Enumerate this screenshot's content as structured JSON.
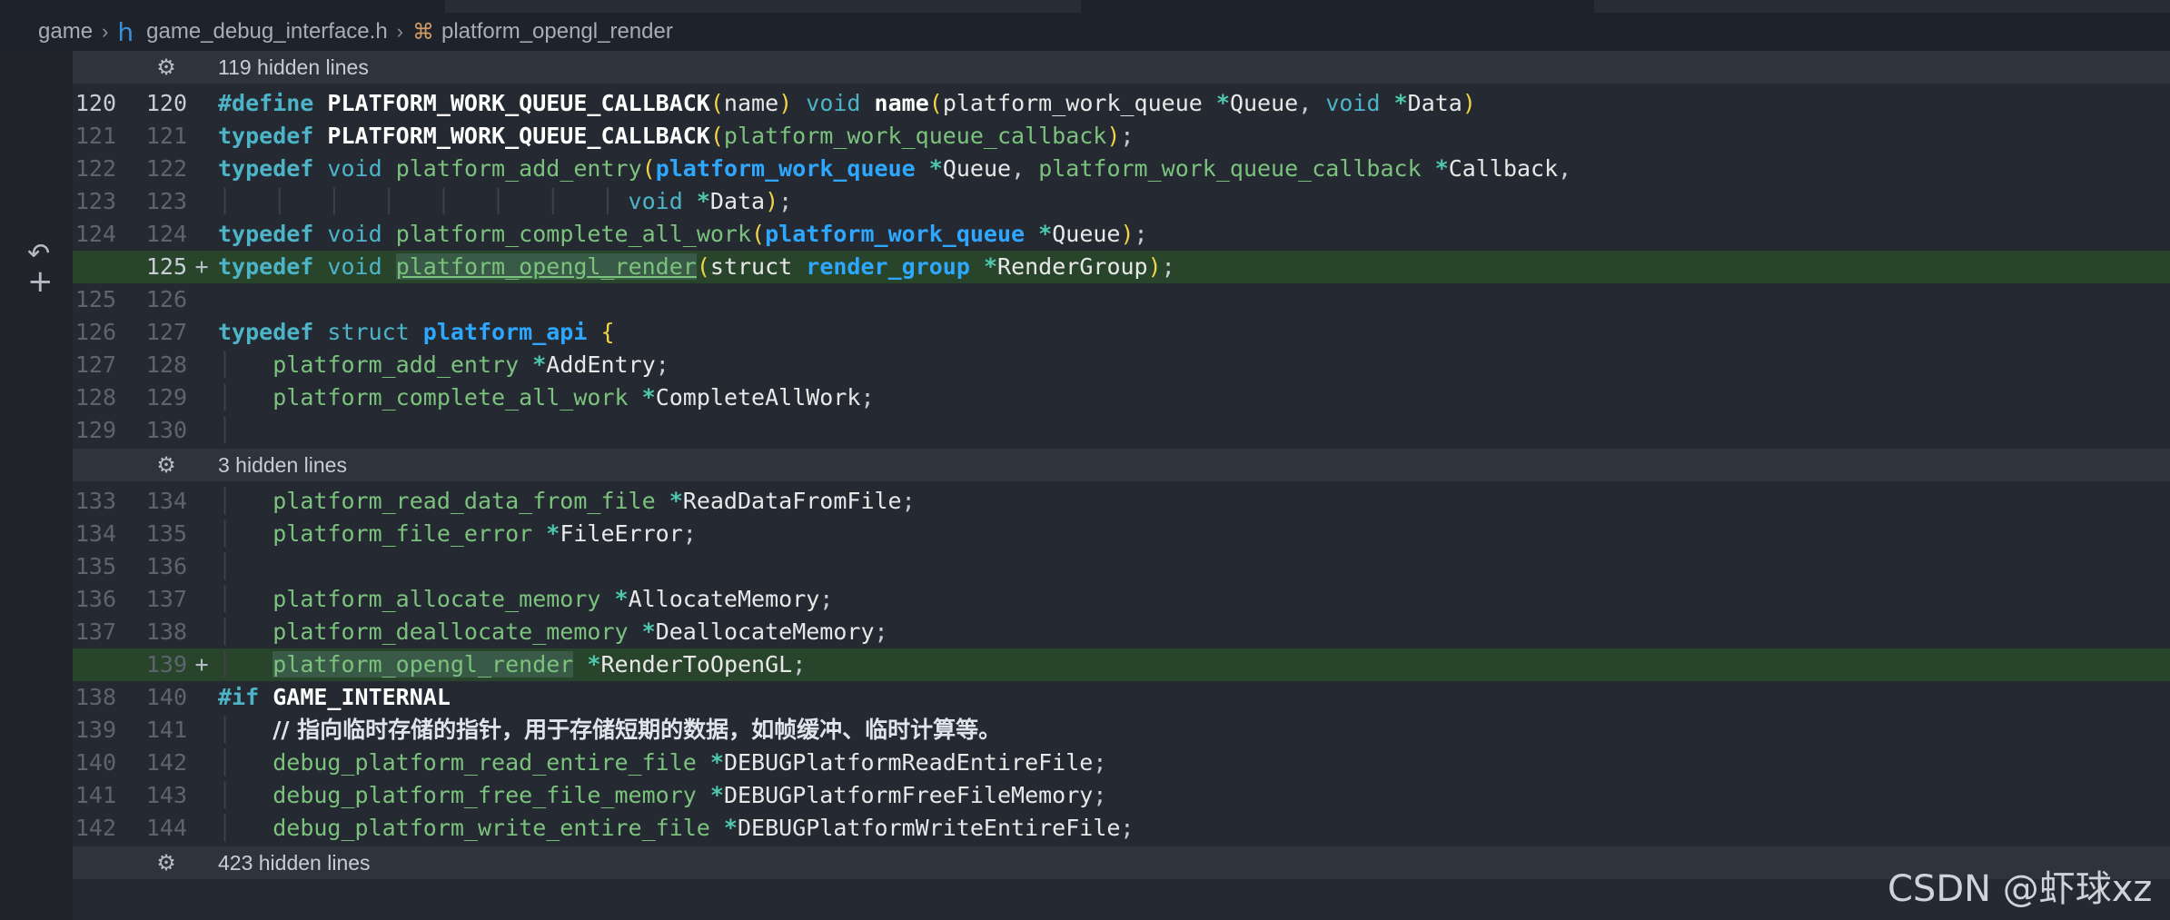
{
  "breadcrumb": {
    "root": "game",
    "file": "game_debug_interface.h",
    "symbol": "platform_opengl_render"
  },
  "folds": [
    {
      "label": "119 hidden lines"
    },
    {
      "label": "3 hidden lines"
    },
    {
      "label": "423 hidden lines"
    }
  ],
  "rows": [
    {
      "ln1": "120",
      "ln2": "120",
      "mark": ""
    },
    {
      "ln1": "121",
      "ln2": "121",
      "mark": ""
    },
    {
      "ln1": "122",
      "ln2": "122",
      "mark": ""
    },
    {
      "ln1": "123",
      "ln2": "123",
      "mark": ""
    },
    {
      "ln1": "124",
      "ln2": "124",
      "mark": ""
    },
    {
      "ln1": "",
      "ln2": "125",
      "mark": "+"
    },
    {
      "ln1": "125",
      "ln2": "126",
      "mark": ""
    },
    {
      "ln1": "126",
      "ln2": "127",
      "mark": ""
    },
    {
      "ln1": "127",
      "ln2": "128",
      "mark": ""
    },
    {
      "ln1": "128",
      "ln2": "129",
      "mark": ""
    },
    {
      "ln1": "129",
      "ln2": "130",
      "mark": ""
    },
    {
      "ln1": "133",
      "ln2": "134",
      "mark": ""
    },
    {
      "ln1": "134",
      "ln2": "135",
      "mark": ""
    },
    {
      "ln1": "135",
      "ln2": "136",
      "mark": ""
    },
    {
      "ln1": "136",
      "ln2": "137",
      "mark": ""
    },
    {
      "ln1": "137",
      "ln2": "138",
      "mark": ""
    },
    {
      "ln1": "",
      "ln2": "139",
      "mark": "+"
    },
    {
      "ln1": "138",
      "ln2": "140",
      "mark": ""
    },
    {
      "ln1": "139",
      "ln2": "141",
      "mark": ""
    },
    {
      "ln1": "140",
      "ln2": "142",
      "mark": ""
    },
    {
      "ln1": "141",
      "ln2": "143",
      "mark": ""
    },
    {
      "ln1": "142",
      "ln2": "144",
      "mark": ""
    }
  ],
  "tokens": {
    "define": "#define",
    "typedef": "typedef",
    "void": "void",
    "struct": "struct",
    "if": "#if",
    "macro": "PLATFORM_WORK_QUEUE_CALLBACK",
    "name_param": "name",
    "name_fn": "name",
    "pwq": "platform_work_queue",
    "queue": "Queue",
    "data": "Data",
    "pwq_cb": "platform_work_queue_callback",
    "add_entry": "platform_add_entry",
    "callback": "Callback",
    "complete_all": "platform_complete_all_work",
    "opengl_render": "platform_opengl_render",
    "render_group": "render_group",
    "render_group_var": "RenderGroup",
    "platform_api": "platform_api",
    "add_entry_member": "AddEntry",
    "complete_member": "CompleteAllWork",
    "read_data_type": "platform_read_data_from_file",
    "read_data_member": "ReadDataFromFile",
    "file_error_type": "platform_file_error",
    "file_error_member": "FileError",
    "alloc_type": "platform_allocate_memory",
    "alloc_member": "AllocateMemory",
    "dealloc_type": "platform_deallocate_memory",
    "dealloc_member": "DeallocateMemory",
    "render_member": "RenderToOpenGL",
    "game_internal": "GAME_INTERNAL",
    "comment": "// 指向临时存储的指针，用于存储短期的数据，如帧缓冲、临时计算等。",
    "dbg_read_type": "debug_platform_read_entire_file",
    "dbg_read_member": "DEBUGPlatformReadEntireFile",
    "dbg_free_type": "debug_platform_free_file_memory",
    "dbg_free_member": "DEBUGPlatformFreeFileMemory",
    "dbg_write_type": "debug_platform_write_entire_file",
    "dbg_write_member": "DEBUGPlatformWriteEntireFile"
  },
  "watermark": "CSDN @虾球xz",
  "icons": {
    "fold": "fold-expand-icon",
    "revert": "revert-icon",
    "add": "add-change-icon",
    "file_type": "header-file-icon",
    "symbol": "symbol-method-icon"
  }
}
